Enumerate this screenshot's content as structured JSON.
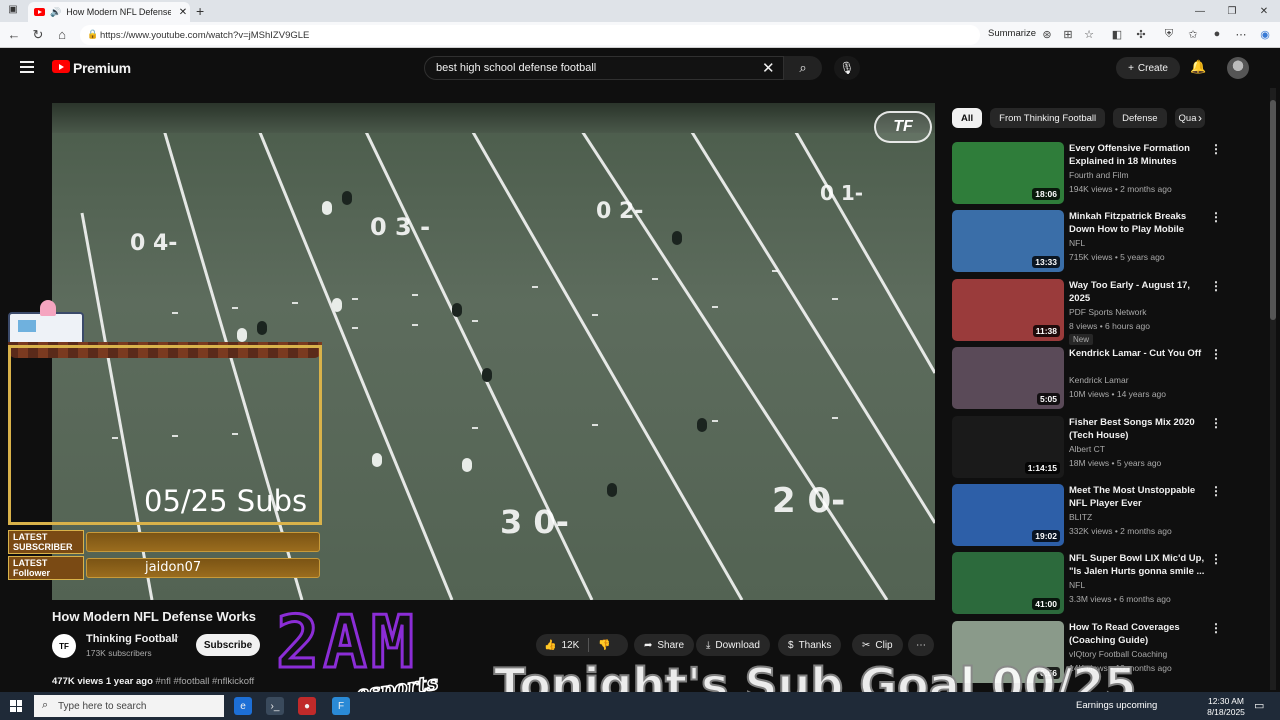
{
  "browser": {
    "tab_title": "How Modern NFL Defense W",
    "url": "https://www.youtube.com/watch?v=jMShIZV9GLE",
    "summarize_label": "Summarize"
  },
  "youtube": {
    "brand": "Premium",
    "search_value": "best high school defense football",
    "create_label": "Create"
  },
  "video": {
    "title": "How Modern NFL Defense Works",
    "channel": "Thinking Football",
    "subscribers": "173K subscribers",
    "subscribe_label": "Subscribe",
    "likes": "12K",
    "share_label": "Share",
    "download_label": "Download",
    "thanks_label": "Thanks",
    "clip_label": "Clip",
    "views": "477K views",
    "age": "1 year ago",
    "tags": "#nfl #football #nflkickoff",
    "channel_logo": "TF",
    "player_logo": "TF",
    "yard_labels": [
      "0 4-",
      "0 3 -",
      "0 2-",
      "0 1-",
      "3 0-",
      "2 0-"
    ]
  },
  "stream_overlay": {
    "subs_count": "05/25 Subs",
    "latest_subscriber_label": "LATEST SUBSCRIBER",
    "latest_subscriber_value": "",
    "latest_follower_label": "LATEST Follower",
    "latest_follower_value": "jaidon07",
    "logo_text": "2AM",
    "logo_sub": "esports",
    "goal_text": "Tonight's Sub Goal 00/25"
  },
  "chips": [
    "All",
    "From Thinking Football",
    "Defense",
    "Qua"
  ],
  "recommendations": [
    {
      "title": "Every Offensive Formation Explained in 18 Minutes",
      "channel": "Fourth and Film",
      "meta": "194K views • 2 months ago",
      "duration": "18:06",
      "thumb": "#2f7d3a"
    },
    {
      "title": "Minkah Fitzpatrick Breaks Down How to Play Mobile QBs, ...",
      "channel": "NFL",
      "meta": "715K views • 5 years ago",
      "duration": "13:33",
      "thumb": "#3a6ea8"
    },
    {
      "title": "Way Too Early - August 17, 2025",
      "channel": "PDF Sports Network",
      "meta": "8 views • 6 hours ago",
      "badge": "New",
      "duration": "11:38",
      "thumb": "#9a3b3b"
    },
    {
      "title": "Kendrick Lamar - Cut You Off",
      "channel": "Kendrick Lamar",
      "meta": "10M views • 14 years ago",
      "duration": "5:05",
      "thumb": "#5a4a58"
    },
    {
      "title": "Fisher Best Songs Mix 2020 (Tech House)",
      "channel": "Albert CT",
      "meta": "18M views • 5 years ago",
      "duration": "1:14:15",
      "thumb": "#1a1a1a"
    },
    {
      "title": "Meet The Most Unstoppable NFL Player Ever",
      "channel": "BLITZ",
      "meta": "332K views • 2 months ago",
      "duration": "19:02",
      "thumb": "#2d5fa8"
    },
    {
      "title": "NFL Super Bowl LIX Mic'd Up, \"Is Jalen Hurts gonna smile ...",
      "channel": "NFL",
      "meta": "3.3M views • 6 months ago",
      "duration": "41:00",
      "thumb": "#2c6a3c"
    },
    {
      "title": "How To Read Coverages (Coaching Guide)",
      "channel": "vIQtory Football Coaching",
      "meta": "14K views • 10 months ago",
      "duration": "6:56",
      "thumb": "#8a9a8a"
    }
  ],
  "taskbar": {
    "search_placeholder": "Type here to search",
    "earnings": "Earnings upcoming",
    "time": "12:30 AM",
    "date": "8/18/2025"
  }
}
